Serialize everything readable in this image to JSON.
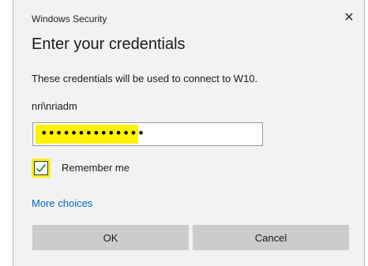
{
  "window": {
    "title": "Windows Security",
    "close_glyph": "✕"
  },
  "heading": "Enter your credentials",
  "description": "These credentials will be used to connect to W10.",
  "username": "nri\\nriadm",
  "password": {
    "masked_value": "••••••••••••••"
  },
  "remember": {
    "label": "Remember me",
    "checked": true
  },
  "more_choices": "More choices",
  "buttons": {
    "ok": "OK",
    "cancel": "Cancel"
  },
  "colors": {
    "highlight": "#fff200",
    "link": "#0067c0",
    "check": "#2a8a3e",
    "button_bg": "#cccccc",
    "dialog_bg": "#f2f2f2"
  }
}
